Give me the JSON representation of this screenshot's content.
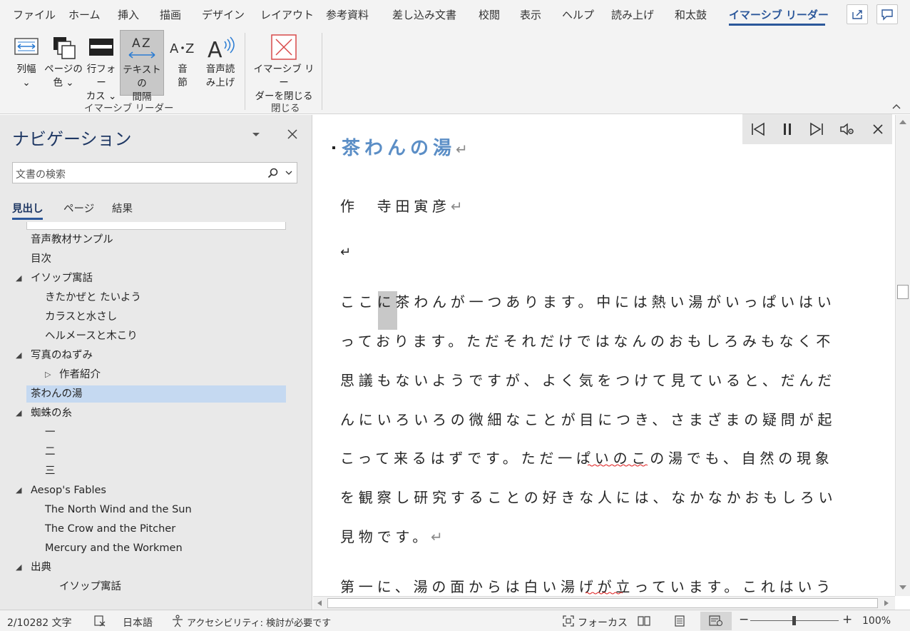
{
  "menu": {
    "tabs": [
      "ファイル",
      "ホーム",
      "挿入",
      "描画",
      "デザイン",
      "レイアウト",
      "参考資料",
      "差し込み文書",
      "校閲",
      "表示",
      "ヘルプ",
      "読み上げ",
      "和太鼓",
      "イマーシブ リーダー"
    ]
  },
  "ribbon": {
    "buttons": [
      {
        "label": "列幅\n⌄"
      },
      {
        "label": "ページの\n色 ⌄"
      },
      {
        "label": "行フォー\nカス ⌄"
      },
      {
        "label": "テキストの\n間隔"
      },
      {
        "label": "音\n節"
      },
      {
        "label": "音声読\nみ上げ"
      },
      {
        "label": "イマーシブ リー\nダーを閉じる"
      }
    ],
    "groups": [
      "イマーシブ リーダー",
      "閉じる"
    ]
  },
  "nav": {
    "title": "ナビゲーション",
    "search_placeholder": "文書の検索",
    "tabs": [
      "見出し",
      "ページ",
      "結果"
    ],
    "items": [
      "音声教材サンプル",
      "目次",
      "イソップ寓話",
      "きたかぜと たいよう",
      "カラスと水さし",
      "ヘルメースと木こり",
      "写真のねずみ",
      "作者紹介",
      "茶わんの湯",
      "蜘蛛の糸",
      "一",
      "二",
      "三",
      "Aesop's Fables",
      "The North Wind and the Sun",
      "The Crow and the Pitcher",
      "Mercury and the Workmen",
      "出典",
      "イソップ寓話"
    ]
  },
  "document": {
    "title": "茶わんの湯",
    "author": "作　寺田寅彦",
    "lines": [
      "ここに茶わんが一つあります。中には熱い湯がいっぱいはい",
      "っております。ただそれだけではなんのおもしろみもなく不",
      "思議もないようですが、よく気をつけて見ていると、だんだ",
      "んにいろいろの微細なことが目につき、さまざまの疑問が起",
      "こって来るはずです。ただ一ぱいのこの湯でも、自然の現象",
      "を観察し研究することの好きな人には、なかなかおもしろい",
      "見物です。",
      "第一に、湯の面からは白い湯げが立っています。これはいう"
    ],
    "para_mark": "↵"
  },
  "status": {
    "word_count": "2/10282 文字",
    "language": "日本語",
    "accessibility": "アクセシビリティ: 検討が必要です",
    "focus": "フォーカス",
    "zoom": "100%"
  }
}
